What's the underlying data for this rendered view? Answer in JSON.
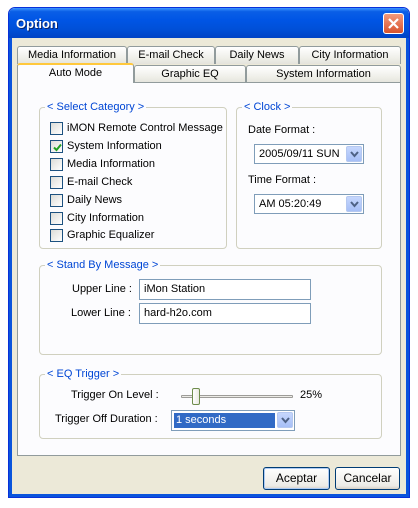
{
  "window": {
    "title": "Option"
  },
  "tabs": {
    "row_back": [
      "Media Information",
      "E-mail Check",
      "Daily News",
      "City Information"
    ],
    "row_front": [
      "Auto Mode",
      "Graphic EQ",
      "System Information"
    ],
    "active": "Auto Mode"
  },
  "category": {
    "title": "< Select Category >",
    "items": [
      {
        "label": "iMON Remote Control Message",
        "checked": false
      },
      {
        "label": "System Information",
        "checked": true
      },
      {
        "label": "Media Information",
        "checked": false
      },
      {
        "label": "E-mail Check",
        "checked": false
      },
      {
        "label": "Daily News",
        "checked": false
      },
      {
        "label": "City Information",
        "checked": false
      },
      {
        "label": "Graphic Equalizer",
        "checked": false
      }
    ]
  },
  "clock": {
    "title": "< Clock >",
    "date_label": "Date Format :",
    "date_value": "2005/09/11 SUN",
    "time_label": "Time Format :",
    "time_value": "AM 05:20:49"
  },
  "standby": {
    "title": "< Stand By Message >",
    "upper_label": "Upper Line :",
    "upper_value": "iMon Station",
    "lower_label": "Lower Line :",
    "lower_value": "hard-h2o.com"
  },
  "eq_trigger": {
    "title": "< EQ Trigger >",
    "on_label": "Trigger On Level :",
    "on_value": "25%",
    "on_level": 0.25,
    "off_label": "Trigger Off Duration :",
    "off_value": "1 seconds"
  },
  "buttons": {
    "ok": "Aceptar",
    "cancel": "Cancelar"
  },
  "colors": {
    "group_title": "#0046d5",
    "title_bar": "#0055e5",
    "selection": "#316ac5"
  }
}
